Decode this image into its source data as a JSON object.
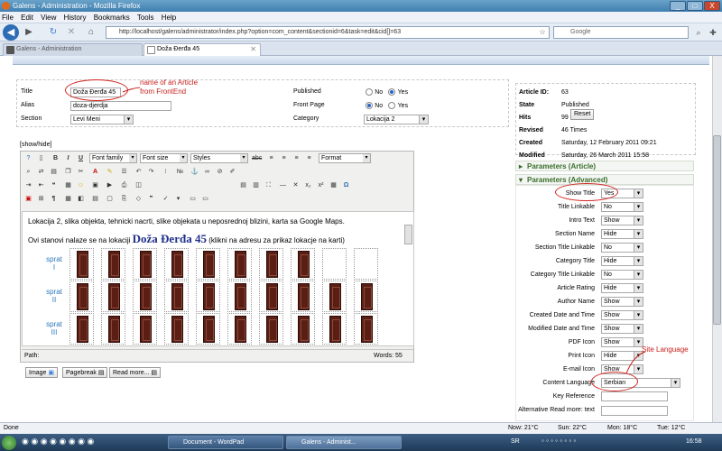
{
  "window": {
    "title": "Galens - Administration - Mozilla Firefox",
    "min": "_",
    "max": "□",
    "close": "X"
  },
  "menu": [
    "File",
    "Edit",
    "View",
    "History",
    "Bookmarks",
    "Tools",
    "Help"
  ],
  "nav": {
    "url": "http://localhost/galens/administrator/index.php?option=com_content&sectionid=6&task=edit&cid[]=63",
    "search_placeholder": "Google"
  },
  "tabs": [
    {
      "label": "Galens - Administration"
    },
    {
      "label": "Doža Đerđa 45"
    }
  ],
  "form": {
    "title_label": "Title",
    "title_value": "Doža Đerđa 45",
    "alias_label": "Alias",
    "alias_value": "doza-djerdja",
    "section_label": "Section",
    "section_value": "Levi Meni",
    "published_label": "Published",
    "frontpage_label": "Front Page",
    "no_label": "No",
    "yes_label": "Yes",
    "category_label": "Category",
    "category_value": "Lokacija 2",
    "annotation_title": "name of an Article\nfrom FrontEnd"
  },
  "editor": {
    "showhide": "[show/hide]",
    "font_family": "Font family",
    "font_size": "Font size",
    "styles": "Styles",
    "format": "Format",
    "para1": "Lokacija 2, slika objekta, tehnicki nacrti, slike objekata u neposrednoj blizini, karta sa Google Maps.",
    "para2_pre": "Ovi stanovi nalaze se na lokaciji",
    "para2_big": "Doža Đerđa 45",
    "para2_post": "(klikni na adresu za prikaz lokacje na karti)",
    "floors": [
      "sprat\nI",
      "sprat\nII",
      "sprat\nIII"
    ],
    "path_label": "Path:",
    "words_label": "Words: 55",
    "btn_image": "Image",
    "btn_pagebreak": "Pagebreak",
    "btn_readmore": "Read more..."
  },
  "info": [
    {
      "k": "Article ID:",
      "v": "63"
    },
    {
      "k": "State",
      "v": "Published"
    },
    {
      "k": "Hits",
      "v": "99"
    },
    {
      "k": "Revised",
      "v": "46 Times"
    },
    {
      "k": "Created",
      "v": "Saturday, 12 February 2011 09:21"
    },
    {
      "k": "Modified",
      "v": "Saturday, 26 March 2011 15:58"
    }
  ],
  "reset_label": "Reset",
  "params_article": "Parameters (Article)",
  "params_advanced": "Parameters (Advanced)",
  "params": [
    {
      "label": "Show Title",
      "value": "Yes"
    },
    {
      "label": "Title Linkable",
      "value": "No"
    },
    {
      "label": "Intro Text",
      "value": "Show"
    },
    {
      "label": "Section Name",
      "value": "Hide"
    },
    {
      "label": "Section Title Linkable",
      "value": "No"
    },
    {
      "label": "Category Title",
      "value": "Hide"
    },
    {
      "label": "Category Title Linkable",
      "value": "No"
    },
    {
      "label": "Article Rating",
      "value": "Hide"
    },
    {
      "label": "Author Name",
      "value": "Show"
    },
    {
      "label": "Created Date and Time",
      "value": "Show"
    },
    {
      "label": "Modified Date and Time",
      "value": "Show"
    },
    {
      "label": "PDF Icon",
      "value": "Show"
    },
    {
      "label": "Print Icon",
      "value": "Hide"
    },
    {
      "label": "E-mail Icon",
      "value": "Show"
    }
  ],
  "content_language_label": "Content Language",
  "content_language_value": "Serbian",
  "key_reference_label": "Key Reference",
  "alt_readmore_label": "Alternative Read more: text",
  "annotation_language": "Site Language",
  "status": {
    "done": "Done",
    "weather": [
      "Now: 21°C",
      "Sun: 22°C",
      "Mon: 18°C",
      "Tue: 12°C"
    ],
    "show_weather": "Show: 16°C"
  },
  "taskbar": {
    "tasks": [
      "Document - WordPad",
      "Galens - Administ..."
    ],
    "lang": "SR",
    "time": "16:58"
  }
}
